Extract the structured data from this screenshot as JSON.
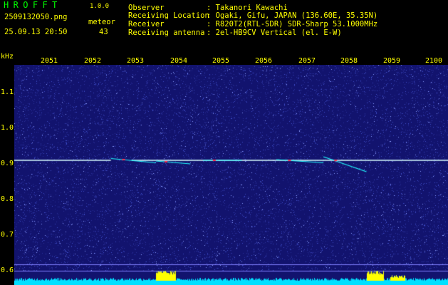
{
  "header": {
    "app_name": "HROFFT",
    "app_version": "1.0.0",
    "file_name": "2509132050.png",
    "datetime": "25.09.13 20:50",
    "meteor_label": "meteor",
    "meteor_count": "43"
  },
  "info": [
    {
      "label": "Observer",
      "value": ": Takanori Kawachi"
    },
    {
      "label": "Receiving Location",
      "value": ": Ogaki, Gifu, JAPAN (136.60E, 35.35N)"
    },
    {
      "label": "Receiver",
      "value": ": R820T2(RTL-SDR) SDR-Sharp 53.1000MHz"
    },
    {
      "label": "Receiving antenna",
      "value": ": 2el-HB9CV Vertical (el. E-W)"
    }
  ],
  "chart_data": {
    "type": "heatmap",
    "ylabel": "kHz",
    "x_ticks": [
      "2051",
      "2052",
      "2053",
      "2054",
      "2055",
      "2056",
      "2057",
      "2058",
      "2059",
      "2100"
    ],
    "y_ticks": [
      "1.1",
      "1.0",
      "0.9",
      "0.8",
      "0.7",
      "0.6"
    ],
    "ylim": [
      0.6,
      1.2
    ],
    "xlim_minutes": [
      0,
      10
    ],
    "carrier_frequency_khz": 0.9,
    "carrier_gap_minutes": [
      2.25,
      2.4
    ],
    "meteor_echoes": [
      {
        "start_min": 2.25,
        "end_min": 3.3,
        "f_start": 0.905,
        "f_end": 0.893
      },
      {
        "start_min": 3.3,
        "end_min": 4.1,
        "f_start": 0.898,
        "f_end": 0.89
      },
      {
        "start_min": 4.4,
        "end_min": 5.3,
        "f_start": 0.9,
        "f_end": 0.9
      },
      {
        "start_min": 6.1,
        "end_min": 7.2,
        "f_start": 0.902,
        "f_end": 0.893
      },
      {
        "start_min": 7.2,
        "end_min": 8.2,
        "f_start": 0.91,
        "f_end": 0.868
      }
    ],
    "colors": {
      "background": "#12136e",
      "noise": "#3d4cc8",
      "carrier": "#d8ffff",
      "echo": "#20ffff",
      "echo_hot": "#ff3050",
      "signal_bar": "#00e0ff",
      "signal_peak": "#ffff00",
      "grid_line": "#8080ff",
      "axis_text": "#ffff00"
    }
  }
}
